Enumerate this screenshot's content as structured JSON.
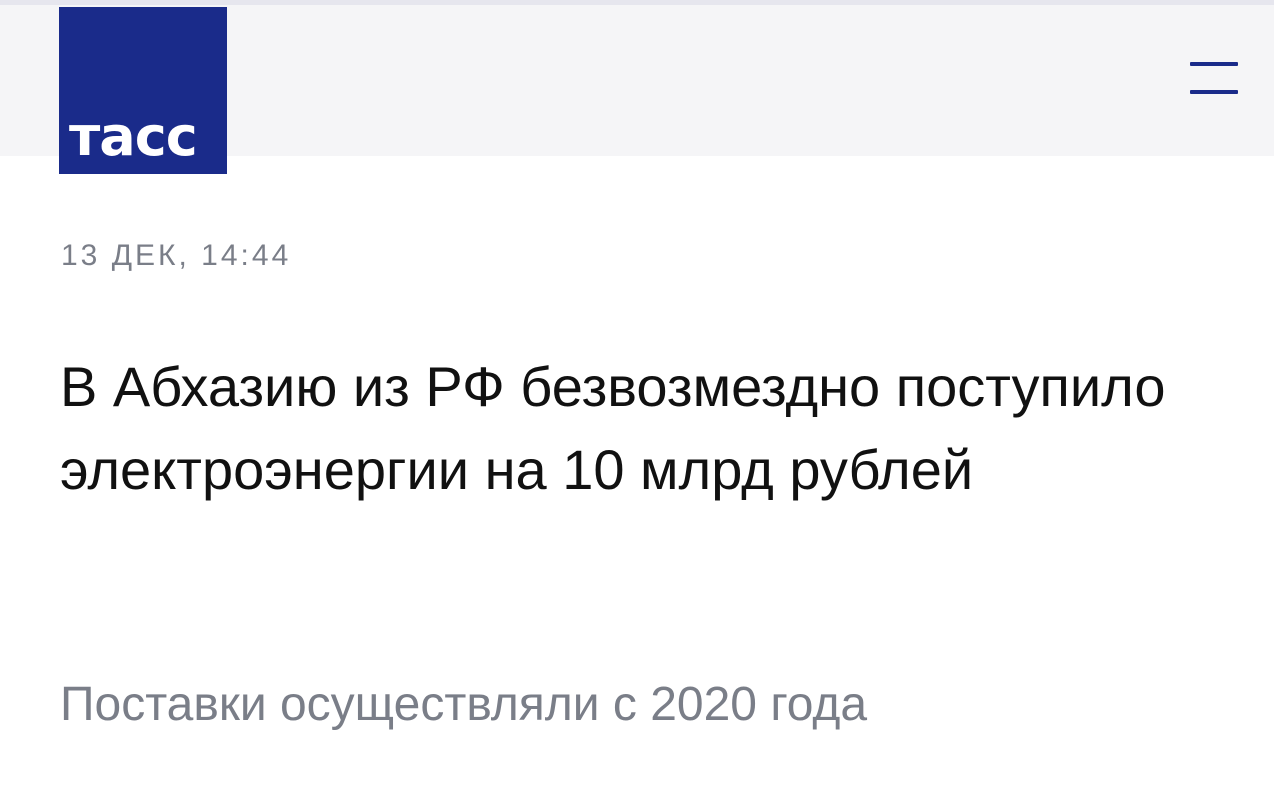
{
  "header": {
    "logo_text": "тасс",
    "brand_color": "#1a2b8a",
    "menu_icon": "hamburger-menu-icon"
  },
  "article": {
    "date": "13 ДЕК, 14:44",
    "headline": "В Абхазию из РФ безвозмездно поступило электроэнергии на 10 млрд рублей",
    "subtitle": "Поставки осуществляли с 2020 года"
  }
}
